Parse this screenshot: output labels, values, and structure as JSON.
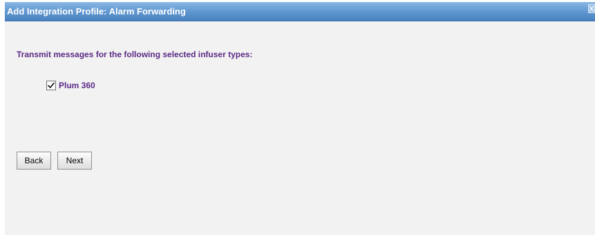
{
  "dialog": {
    "title": "Add Integration Profile: Alarm Forwarding",
    "close_icon": "close-icon"
  },
  "main": {
    "instruction": "Transmit messages for the following selected infuser types:",
    "options": [
      {
        "label": "Plum 360",
        "checked": true,
        "icon": "checkmark-icon"
      }
    ]
  },
  "buttons": {
    "back_label": "Back",
    "next_label": "Next"
  },
  "colors": {
    "title_bar": "#5d95cf",
    "text_accent": "#5b2a86",
    "panel_background": "#f2f2f2"
  }
}
